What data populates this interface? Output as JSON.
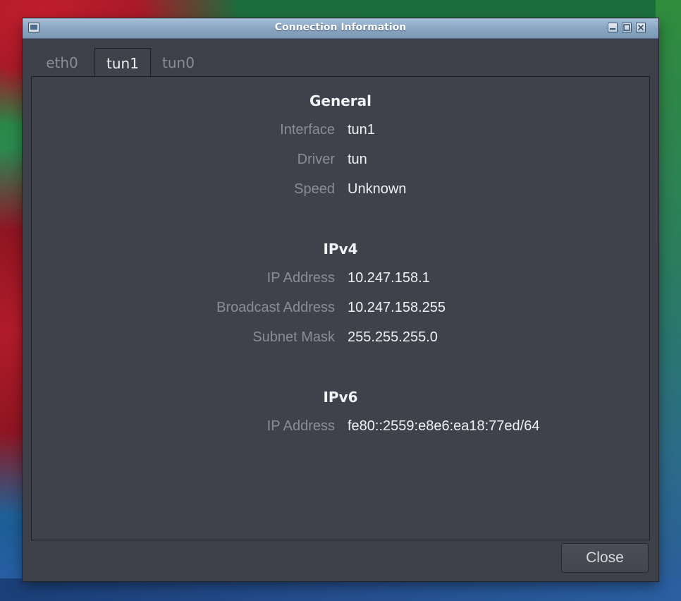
{
  "window": {
    "title": "Connection Information"
  },
  "tabs": [
    {
      "label": "eth0",
      "active": false
    },
    {
      "label": "tun1",
      "active": true
    },
    {
      "label": "tun0",
      "active": false
    }
  ],
  "sections": {
    "general": {
      "title": "General",
      "rows": [
        {
          "label": "Interface",
          "value": "tun1"
        },
        {
          "label": "Driver",
          "value": "tun"
        },
        {
          "label": "Speed",
          "value": "Unknown"
        }
      ]
    },
    "ipv4": {
      "title": "IPv4",
      "rows": [
        {
          "label": "IP Address",
          "value": "10.247.158.1"
        },
        {
          "label": "Broadcast Address",
          "value": "10.247.158.255"
        },
        {
          "label": "Subnet Mask",
          "value": "255.255.255.0"
        }
      ]
    },
    "ipv6": {
      "title": "IPv6",
      "rows": [
        {
          "label": "IP Address",
          "value": "fe80::2559:e8e6:ea18:77ed/64"
        }
      ]
    }
  },
  "buttons": {
    "close_label": "Close"
  },
  "icons": {
    "app": "network-window-icon",
    "minimize": "minimize-icon",
    "maximize": "maximize-icon",
    "close": "close-icon"
  },
  "colors": {
    "titlebar": "#8aa6c2",
    "window_bg": "#3e4049",
    "panel_bg": "#40424b",
    "label_text": "#8a8d95",
    "value_text": "#f0f0f2"
  }
}
